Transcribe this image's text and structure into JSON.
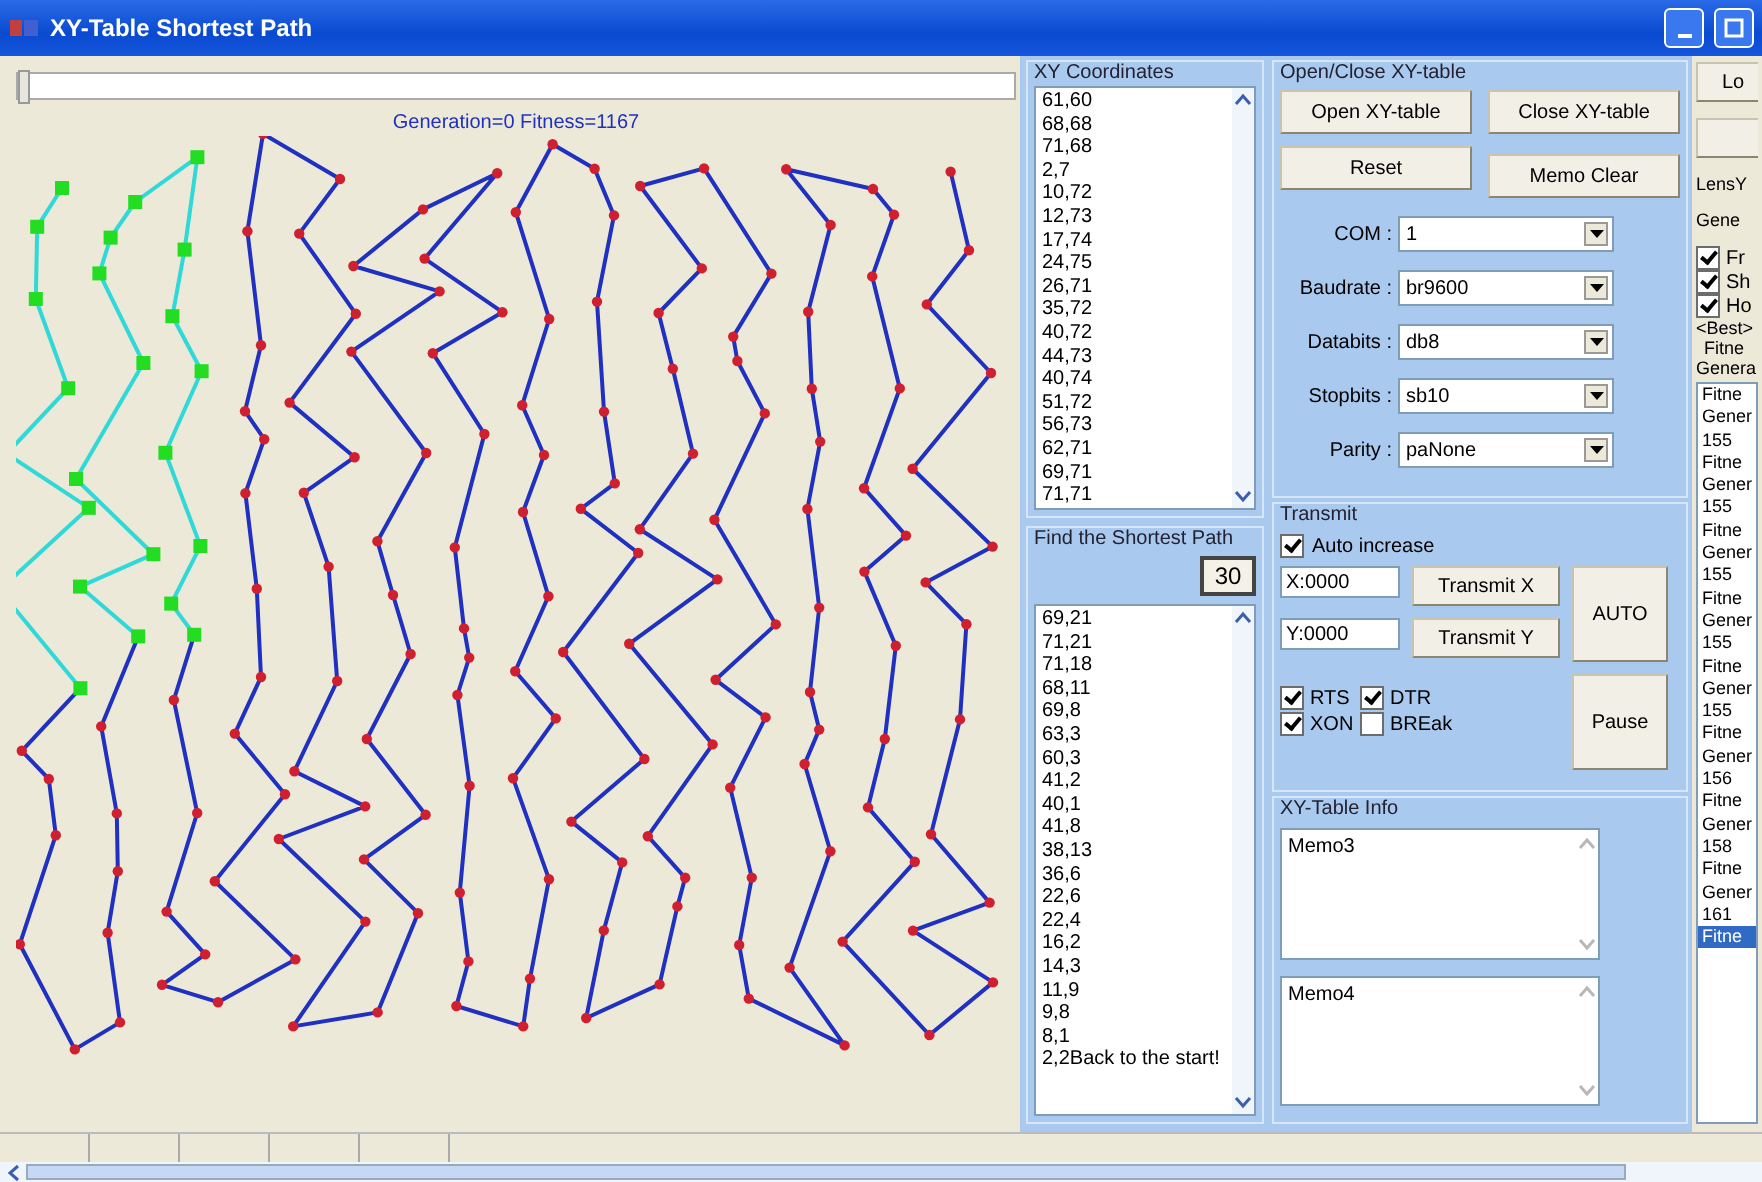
{
  "window": {
    "title": "XY-Table Shortest Path"
  },
  "trackbar": {
    "level": 0
  },
  "canvas": {
    "caption": "Generation=0 Fitness=1167"
  },
  "coordinates": {
    "title": "XY Coordinates",
    "items": [
      "61,60",
      "68,68",
      "71,68",
      "2,7",
      "10,72",
      "12,73",
      "17,74",
      "24,75",
      "26,71",
      "35,72",
      "40,72",
      "44,73",
      "40,74",
      "51,72",
      "56,73",
      "62,71",
      "69,71",
      "71,71"
    ]
  },
  "shortest_path": {
    "title": "Find the Shortest Path",
    "count": "30",
    "items": [
      "69,21",
      "71,21",
      "71,18",
      "68,11",
      "69,8",
      "63,3",
      "60,3",
      "41,2",
      "40,1",
      "41,8",
      "38,13",
      "36,6",
      "22,6",
      "22,4",
      "16,2",
      "14,3",
      "11,9",
      "9,8",
      "8,1",
      "2,2Back to the start!"
    ]
  },
  "xy_table": {
    "title": "Open/Close XY-table",
    "buttons": [
      "Open XY-table",
      "Close XY-table",
      "Reset",
      "Memo Clear"
    ],
    "settings": [
      {
        "label": "COM :",
        "value": "1"
      },
      {
        "label": "Baudrate :",
        "value": "br9600"
      },
      {
        "label": "Databits :",
        "value": "db8"
      },
      {
        "label": "Stopbits :",
        "value": "sb10"
      },
      {
        "label": "Parity :",
        "value": "paNone"
      }
    ]
  },
  "transmit": {
    "title": "Transmit",
    "auto_increase": {
      "label": "Auto increase",
      "checked": true
    },
    "fields": [
      {
        "value": "X:0000",
        "button": "Transmit X"
      },
      {
        "value": "Y:0000",
        "button": "Transmit Y"
      }
    ],
    "buttons": [
      "AUTO",
      "Pause"
    ],
    "options": [
      {
        "label": "RTS",
        "checked": true
      },
      {
        "label": "DTR",
        "checked": true
      },
      {
        "label": "XON",
        "checked": true
      },
      {
        "label": "BREak",
        "checked": false
      }
    ]
  },
  "info": {
    "title": "XY-Table Info",
    "memos": [
      "Memo3",
      "Memo4"
    ]
  },
  "side": {
    "button": "Lo",
    "labels": [
      "LensY",
      "Gene"
    ],
    "checks": [
      {
        "label": "Fr",
        "checked": true
      },
      {
        "label": "Sh",
        "checked": true
      },
      {
        "label": "Ho",
        "checked": true
      }
    ],
    "best": "<Best>",
    "fitness": "Fitne",
    "generation": "Genera",
    "list": [
      {
        "text": "Fitne",
        "selected": false
      },
      {
        "text": "Gener",
        "selected": false
      },
      {
        "text": "155",
        "selected": false
      },
      {
        "text": "Fitne",
        "selected": false
      },
      {
        "text": "Gener",
        "selected": false
      },
      {
        "text": "155",
        "selected": false
      },
      {
        "text": "Fitne",
        "selected": false
      },
      {
        "text": "Gener",
        "selected": false
      },
      {
        "text": "155",
        "selected": false
      },
      {
        "text": "Fitne",
        "selected": false
      },
      {
        "text": "Gener",
        "selected": false
      },
      {
        "text": "155",
        "selected": false
      },
      {
        "text": "Fitne",
        "selected": false
      },
      {
        "text": "Gener",
        "selected": false
      },
      {
        "text": "155",
        "selected": false
      },
      {
        "text": "Fitne",
        "selected": false
      },
      {
        "text": "Gener",
        "selected": false
      },
      {
        "text": "156",
        "selected": false
      },
      {
        "text": "Fitne",
        "selected": false
      },
      {
        "text": "Gener",
        "selected": false
      },
      {
        "text": "158",
        "selected": false
      },
      {
        "text": "Fitne",
        "selected": false
      },
      {
        "text": "Gener",
        "selected": false
      },
      {
        "text": "161",
        "selected": false
      },
      {
        "text": "Fitne",
        "selected": true
      }
    ]
  }
}
